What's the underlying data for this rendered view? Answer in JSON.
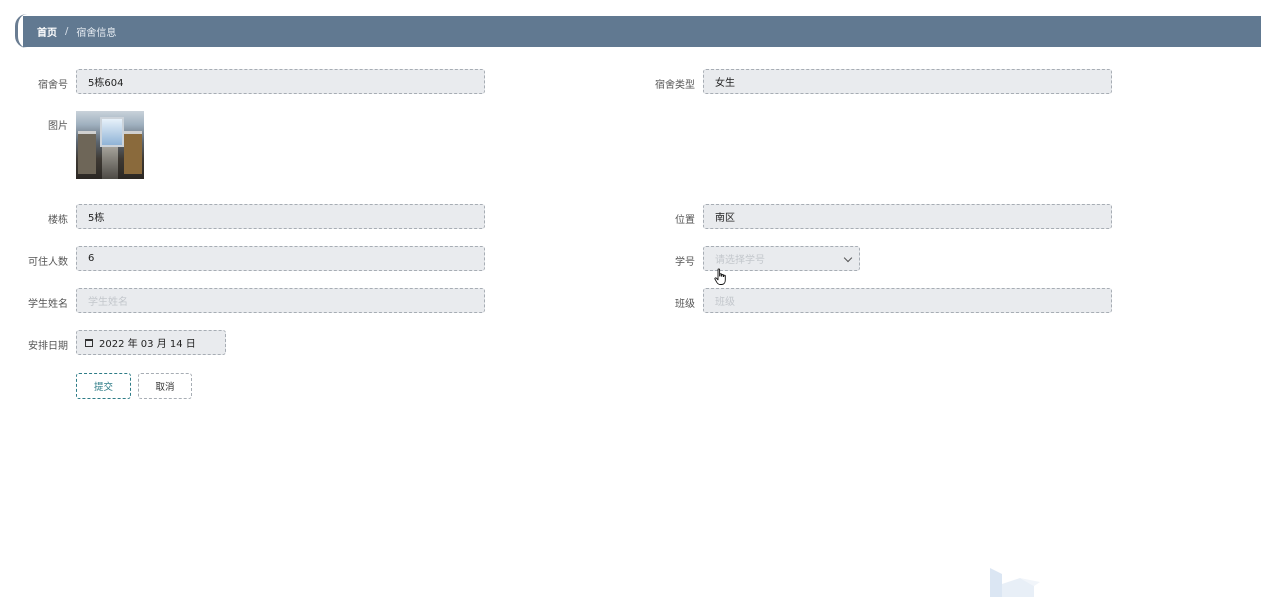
{
  "breadcrumb": {
    "home": "首页",
    "separator": "/",
    "current": "宿舍信息"
  },
  "form": {
    "dorm_no": {
      "label": "宿舍号",
      "value": "5栋604"
    },
    "dorm_type": {
      "label": "宿舍类型",
      "value": "女生"
    },
    "image": {
      "label": "图片"
    },
    "building": {
      "label": "楼栋",
      "value": "5栋"
    },
    "location": {
      "label": "位置",
      "value": "南区"
    },
    "capacity": {
      "label": "可住人数",
      "value": "6"
    },
    "student_id": {
      "label": "学号",
      "placeholder": "请选择学号"
    },
    "student_name": {
      "label": "学生姓名",
      "placeholder": "学生姓名"
    },
    "class": {
      "label": "班级",
      "placeholder": "班级"
    },
    "arrange_date": {
      "label": "安排日期",
      "value": "2022 年 03 月 14 日"
    }
  },
  "buttons": {
    "submit": "提交",
    "cancel": "取消"
  }
}
